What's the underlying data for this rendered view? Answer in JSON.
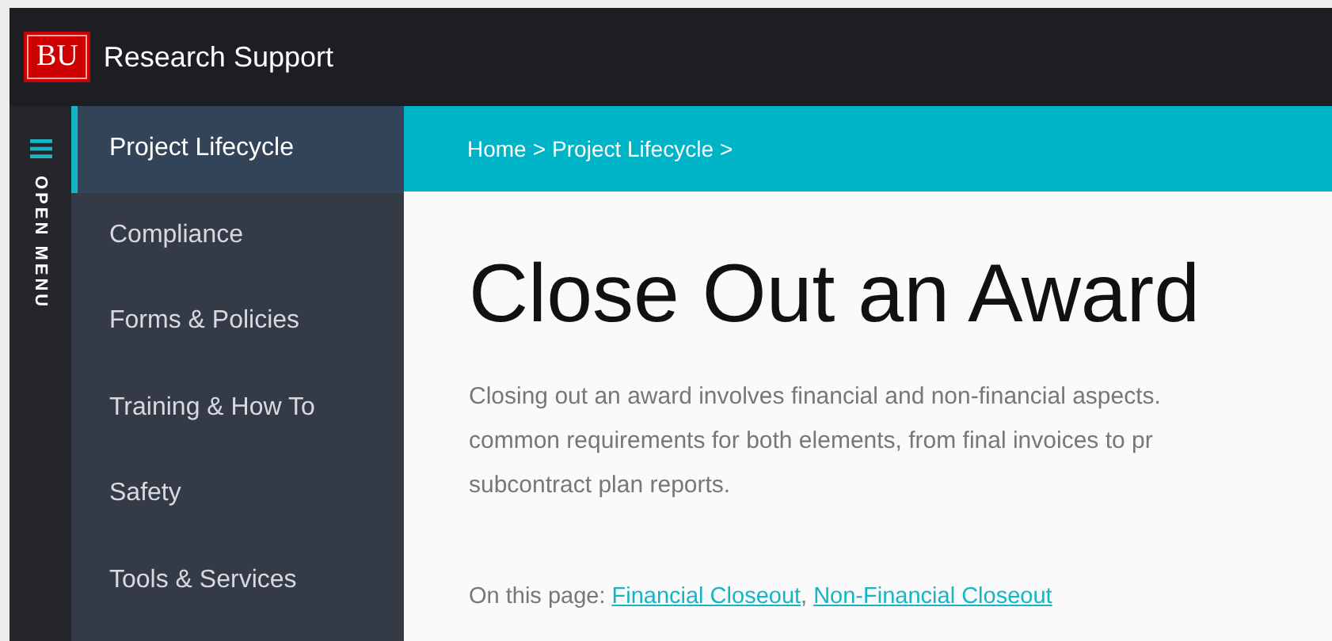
{
  "header": {
    "logo": "BU",
    "title": "Research Support"
  },
  "rail": {
    "label": "OPEN MENU"
  },
  "sidebar": {
    "items": [
      {
        "label": "Project Lifecycle",
        "selected": true
      },
      {
        "label": "Compliance",
        "selected": false
      },
      {
        "label": "Forms & Policies",
        "selected": false
      },
      {
        "label": "Training & How To",
        "selected": false
      },
      {
        "label": "Safety",
        "selected": false
      },
      {
        "label": "Tools & Services",
        "selected": false
      }
    ]
  },
  "breadcrumb": {
    "items": [
      "Home",
      "Project Lifecycle"
    ],
    "separator": ">"
  },
  "content": {
    "title": "Close Out an Award",
    "intro_lines": [
      "Closing out an award involves financial and non-financial aspects.",
      "common requirements for both elements, from final invoices to pr",
      "subcontract plan reports."
    ],
    "on_this_page": {
      "label": "On this page:",
      "separator": ",",
      "links": [
        "Financial Closeout",
        "Non-Financial Closeout"
      ]
    }
  }
}
